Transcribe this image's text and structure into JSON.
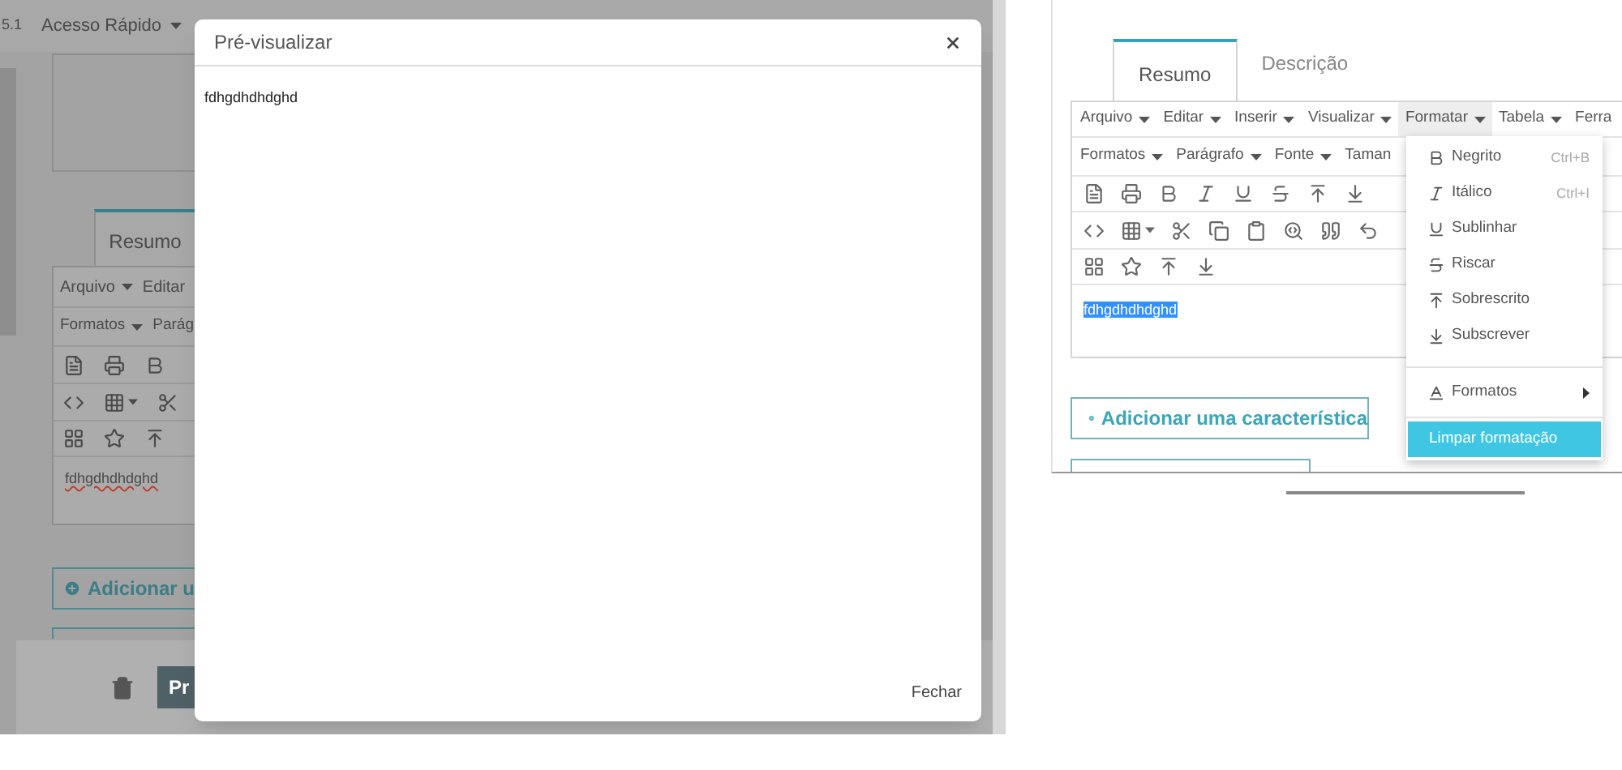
{
  "left_screen": {
    "top_bar": {
      "version": "5.1",
      "quick_access": "Acesso Rápido"
    },
    "tabs": [
      {
        "label": "Resumo",
        "selected": true
      }
    ],
    "menubar": [
      {
        "label": "Arquivo",
        "caret": true
      },
      {
        "label": "Editar",
        "caret": false
      }
    ],
    "format_bar": [
      {
        "label": "Formatos",
        "caret": true
      },
      {
        "label": "Parág",
        "caret": false
      }
    ],
    "editor": {
      "text": "fdhgdhdhdghd",
      "spellcheck_error": true
    },
    "add_button": "Adicionar u",
    "preview_button": "Pr",
    "modal": {
      "title": "Pré-visualizar",
      "body": "fdhgdhdhdghd",
      "close_link": "Fechar"
    }
  },
  "right_screen": {
    "tabs": [
      {
        "label": "Resumo",
        "selected": true
      },
      {
        "label": "Descrição",
        "selected": false
      }
    ],
    "menubar": [
      {
        "label": "Arquivo",
        "caret": true,
        "selected": false
      },
      {
        "label": "Editar",
        "caret": true,
        "selected": false
      },
      {
        "label": "Inserir",
        "caret": true,
        "selected": false
      },
      {
        "label": "Visualizar",
        "caret": true,
        "selected": false
      },
      {
        "label": "Formatar",
        "caret": true,
        "selected": true
      },
      {
        "label": "Tabela",
        "caret": true,
        "selected": false
      },
      {
        "label": "Ferra",
        "caret": false,
        "selected": false
      }
    ],
    "format_bar": [
      {
        "label": "Formatos",
        "caret": true
      },
      {
        "label": "Parágrafo",
        "caret": true
      },
      {
        "label": "Fonte",
        "caret": true
      },
      {
        "label": "Taman",
        "caret": false
      }
    ],
    "editor": {
      "text": "fdhgdhdhdghd",
      "text_selected": true
    },
    "add_button": "Adicionar uma característica",
    "format_menu": [
      {
        "kind": "item",
        "label": "Negrito",
        "shortcut": "Ctrl+B",
        "selected": false
      },
      {
        "kind": "item",
        "label": "Itálico",
        "shortcut": "Ctrl+I",
        "selected": false
      },
      {
        "kind": "item",
        "label": "Sublinhar",
        "selected": false
      },
      {
        "kind": "item",
        "label": "Riscar",
        "selected": false
      },
      {
        "kind": "item",
        "label": "Sobrescrito",
        "selected": false
      },
      {
        "kind": "item",
        "label": "Subscrever",
        "selected": false
      },
      {
        "kind": "submenu",
        "label": "Formatos",
        "selected": false
      },
      {
        "kind": "action",
        "label": "Limpar formatação",
        "selected": true
      }
    ]
  }
}
